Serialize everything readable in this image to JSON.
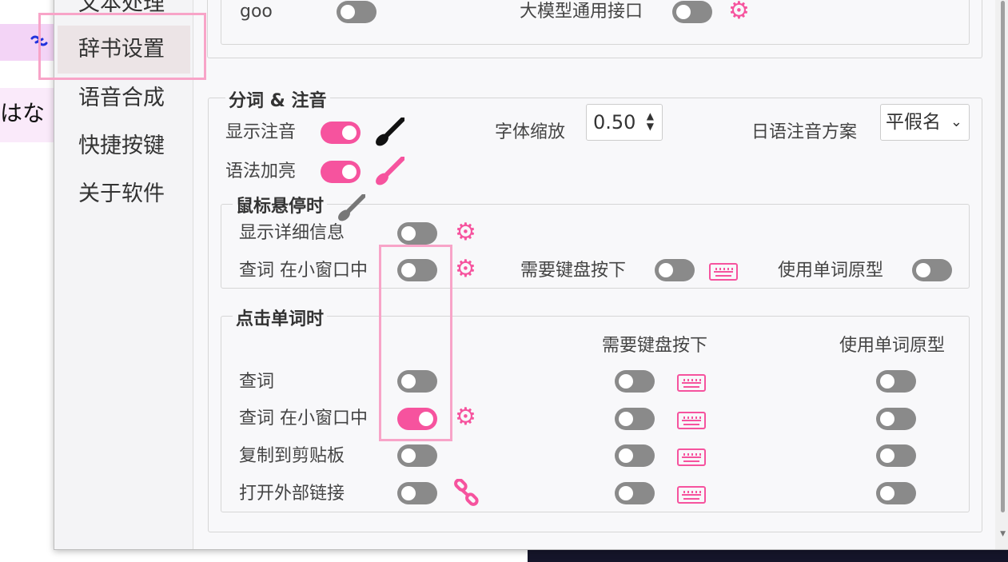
{
  "background": {
    "partial_text": "はな"
  },
  "sidebar": {
    "items": [
      {
        "label": "文本处理"
      },
      {
        "label": "辞书设置"
      },
      {
        "label": "语音合成"
      },
      {
        "label": "快捷按键"
      },
      {
        "label": "关于软件"
      }
    ],
    "selected_index": 1
  },
  "top_group": {
    "goo_label": "goo",
    "goo_on": false,
    "llm_label": "大模型通用接口",
    "llm_on": false
  },
  "annotation_group": {
    "title": "分词 & 注音",
    "show_ruby_label": "显示注音",
    "show_ruby_on": true,
    "font_scale_label": "字体缩放",
    "font_scale_value": "0.50",
    "jp_ruby_label": "日语注音方案",
    "jp_ruby_value": "平假名",
    "grammar_label": "语法加亮",
    "grammar_on": true
  },
  "hover_group": {
    "title": "鼠标悬停时",
    "detail_label": "显示详细信息",
    "detail_on": false,
    "lookup_small_label": "查词 在小窗口中",
    "lookup_small_on": false,
    "need_key_label": "需要键盘按下",
    "need_key_on": false,
    "use_lemma_label": "使用单词原型",
    "use_lemma_on": false
  },
  "click_group": {
    "title": "点击单词时",
    "col_need_key": "需要键盘按下",
    "col_use_lemma": "使用单词原型",
    "rows": [
      {
        "label": "查词",
        "on": false,
        "key_on": false,
        "lemma_on": false
      },
      {
        "label": "查词 在小窗口中",
        "on": true,
        "key_on": false,
        "lemma_on": false
      },
      {
        "label": "复制到剪贴板",
        "on": false,
        "key_on": false,
        "lemma_on": false
      },
      {
        "label": "打开外部链接",
        "on": false,
        "key_on": false,
        "lemma_on": false
      }
    ]
  },
  "colors": {
    "accent": "#f6539e",
    "toggle_off": "#8a8a8a",
    "highlight_outline": "#f8a4c8"
  }
}
